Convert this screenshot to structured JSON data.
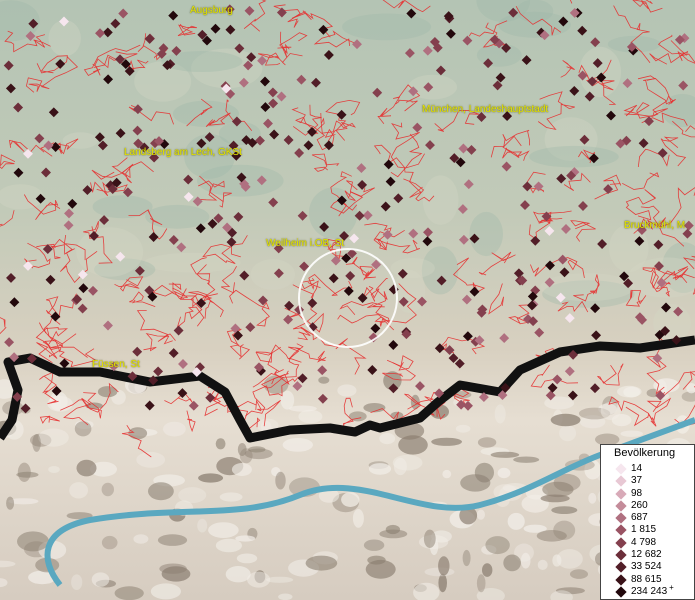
{
  "map": {
    "places": [
      {
        "name": "Augsburg"
      },
      {
        "name": "München, Landeshauptstadt"
      },
      {
        "name": "Landsberg am Lech, GKSt"
      },
      {
        "name": "Weilheim i.OB, St"
      },
      {
        "name": "Bruckmühl, M"
      },
      {
        "name": "Füssen, St"
      }
    ],
    "colors": {
      "boundary": "#e53030",
      "border": "#111111",
      "river": "#5aa8c0",
      "label": "#e6e600",
      "marker_dark": "#2a0a0a",
      "marker_light": "#f6e6ee"
    }
  },
  "legend": {
    "title": "Bevölkerung",
    "items": [
      {
        "label": "14",
        "color": "#f6e6ee"
      },
      {
        "label": "37",
        "color": "#e8c8d4"
      },
      {
        "label": "98",
        "color": "#d8aab8"
      },
      {
        "label": "260",
        "color": "#c48c9a"
      },
      {
        "label": "687",
        "color": "#b07080"
      },
      {
        "label": "1 815",
        "color": "#9a5464"
      },
      {
        "label": "4 798",
        "color": "#84404e"
      },
      {
        "label": "12 682",
        "color": "#6c2e3a"
      },
      {
        "label": "33 524",
        "color": "#521e28"
      },
      {
        "label": "88 615",
        "color": "#3a1218"
      },
      {
        "label": "234 243",
        "color": "#22080c"
      }
    ],
    "overflow_marker": "+"
  }
}
